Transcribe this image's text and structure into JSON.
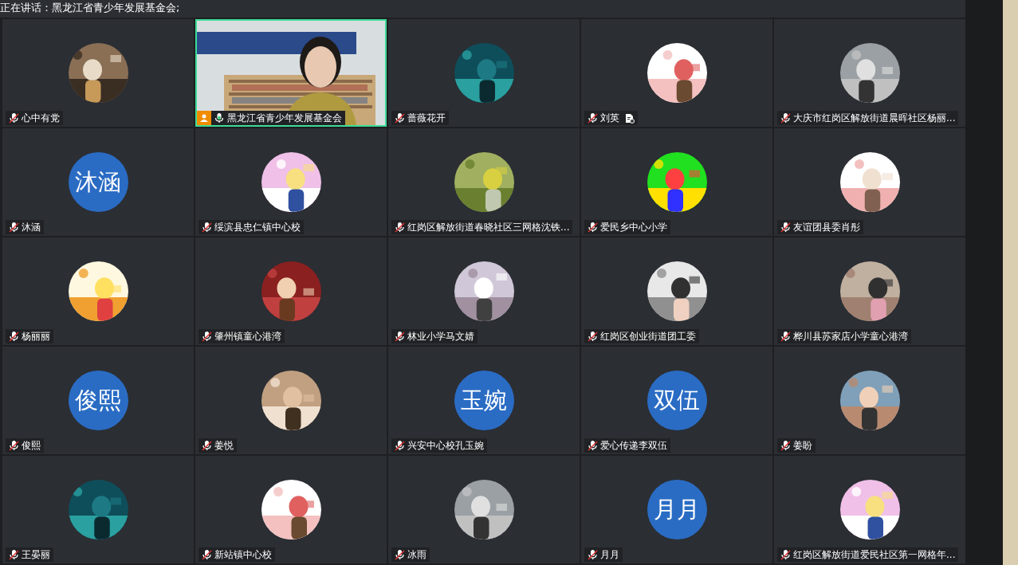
{
  "top_bar": {
    "speaking_text": "正在讲话：黑龙江省青少年发展基金会;"
  },
  "tiles": [
    {
      "name": "心中有党",
      "muted": true,
      "highlighted": false,
      "note": false
    },
    {
      "name": "黑龙江省青少年发展基金会",
      "avatar": {
        "kind": "video"
      },
      "muted": false,
      "highlighted": true,
      "note": false
    },
    {
      "name": "蔷薇花开",
      "muted": true,
      "highlighted": false,
      "note": false
    },
    {
      "name": "刘英",
      "muted": true,
      "highlighted": false,
      "note": true
    },
    {
      "name": "大庆市红岗区解放街道晨晖社区杨丽...",
      "muted": true,
      "highlighted": false,
      "note": false
    },
    {
      "name": "沐涵",
      "avatar": {
        "kind": "initials",
        "text": "沐涵"
      },
      "muted": true,
      "highlighted": false,
      "note": false
    },
    {
      "name": "绥滨县忠仁镇中心校",
      "muted": true,
      "highlighted": false,
      "note": false
    },
    {
      "name": "红岗区解放街道春晓社区三网格沈铁...",
      "muted": true,
      "highlighted": false,
      "note": false
    },
    {
      "name": "爱民乡中心小学",
      "muted": true,
      "highlighted": false,
      "note": false
    },
    {
      "name": "友谊团县委肖彤",
      "muted": true,
      "highlighted": false,
      "note": false
    },
    {
      "name": "杨丽丽",
      "muted": true,
      "highlighted": false,
      "note": false
    },
    {
      "name": "肇州镇童心港湾",
      "muted": true,
      "highlighted": false,
      "note": false
    },
    {
      "name": "林业小学马文婧",
      "muted": true,
      "highlighted": false,
      "note": false
    },
    {
      "name": "红岗区创业街道团工委",
      "muted": true,
      "highlighted": false,
      "note": false
    },
    {
      "name": "桦川县苏家店小学童心港湾",
      "muted": true,
      "highlighted": false,
      "note": false
    },
    {
      "name": "俊熙",
      "avatar": {
        "kind": "initials",
        "text": "俊熙"
      },
      "muted": true,
      "highlighted": false,
      "note": false
    },
    {
      "name": "姜悦",
      "muted": true,
      "highlighted": false,
      "note": false
    },
    {
      "name": "兴安中心校孔玉婉",
      "avatar": {
        "kind": "initials",
        "text": "玉婉"
      },
      "muted": true,
      "highlighted": false,
      "note": false
    },
    {
      "name": "爱心传递李双伍",
      "avatar": {
        "kind": "initials",
        "text": "双伍"
      },
      "muted": true,
      "highlighted": false,
      "note": false
    },
    {
      "name": "姜盼",
      "muted": true,
      "highlighted": false,
      "note": false
    },
    {
      "name": "王晏丽",
      "muted": true,
      "highlighted": false,
      "note": false
    },
    {
      "name": "新站镇中心校",
      "muted": true,
      "highlighted": false,
      "note": false
    },
    {
      "name": "冰雨",
      "muted": true,
      "highlighted": false,
      "note": false
    },
    {
      "name": "月月",
      "avatar": {
        "kind": "initials",
        "text": "月月"
      },
      "muted": true,
      "highlighted": false,
      "note": false
    },
    {
      "name": "红岗区解放街道爱民社区第一网格年...",
      "muted": true,
      "highlighted": false,
      "note": false
    }
  ]
}
